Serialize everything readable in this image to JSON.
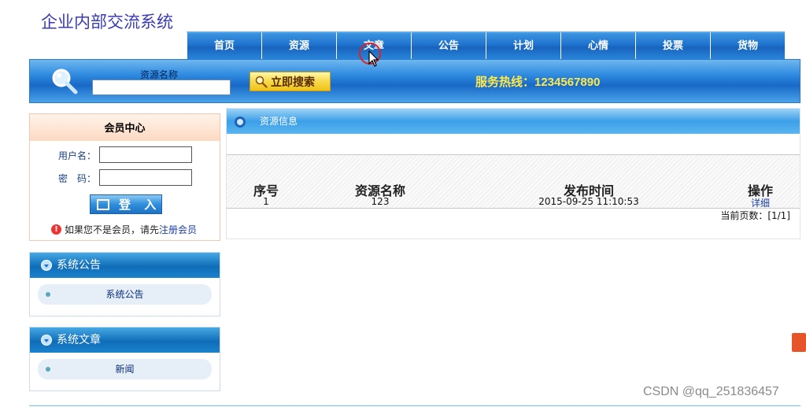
{
  "site": {
    "title": "企业内部交流系统"
  },
  "nav": {
    "items": [
      {
        "label": "首页"
      },
      {
        "label": "资源"
      },
      {
        "label": "文章"
      },
      {
        "label": "公告"
      },
      {
        "label": "计划"
      },
      {
        "label": "心情"
      },
      {
        "label": "投票"
      },
      {
        "label": "货物"
      }
    ]
  },
  "search": {
    "label": "资源名称",
    "value": "",
    "button_label": "立即搜索",
    "hotline": "服务热线：1234567890"
  },
  "member": {
    "title": "会员中心",
    "username_label": "用户名：",
    "password_label": "密　码：",
    "login_button": "登 入",
    "register_prefix": "如果您不是会员，请先",
    "register_link": "注册会员"
  },
  "notice_box": {
    "title": "系统公告",
    "items": [
      {
        "label": "系统公告"
      }
    ]
  },
  "article_box": {
    "title": "系统文章",
    "items": [
      {
        "label": "新闻"
      }
    ]
  },
  "resource": {
    "title": "资源信息",
    "columns": [
      "序号",
      "资源名称",
      "发布时间",
      "操作"
    ],
    "rows": [
      {
        "index": "1",
        "name": "123",
        "time": "2015-09-25 11:10:53",
        "action": "详细"
      }
    ],
    "page_info": "当前页数：[1/1]"
  },
  "watermark": "CSDN @qq_251836457",
  "colors": {
    "nav_blue": "#1b6fcc",
    "hotline_yellow": "#ffe94a",
    "title_blue": "#3a3ab8"
  }
}
